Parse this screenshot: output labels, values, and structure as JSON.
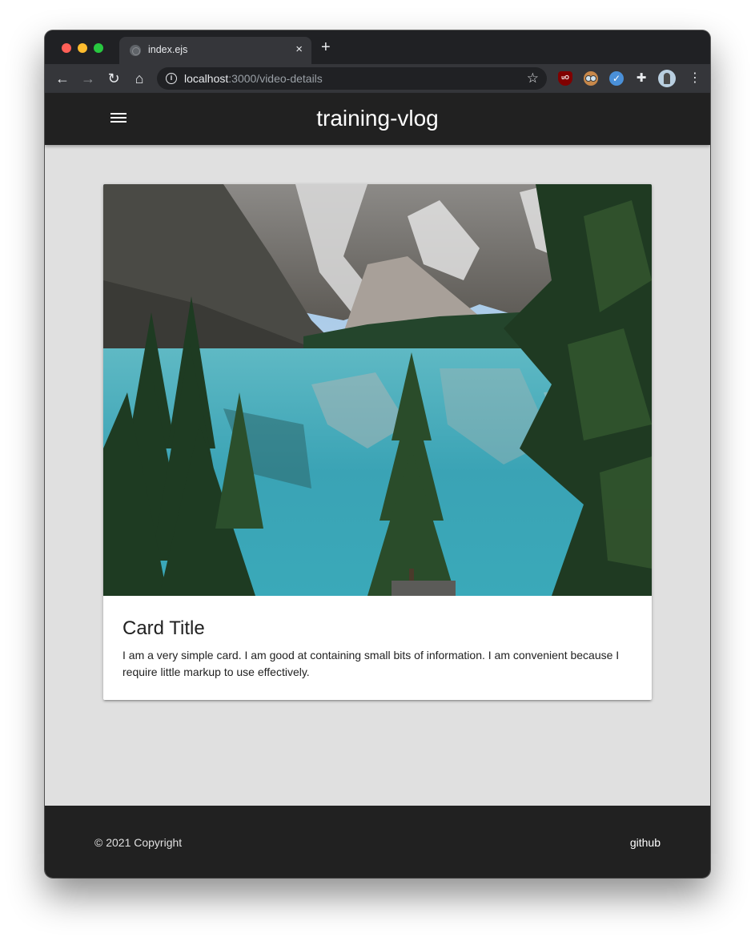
{
  "browser": {
    "tab_title": "index.ejs",
    "tab_close": "×",
    "new_tab": "+",
    "url_host": "localhost",
    "url_rest": ":3000/video-details",
    "nav": {
      "back": "←",
      "forward": "→",
      "reload": "↻",
      "home": "⌂"
    },
    "star": "☆",
    "menu": "⋮",
    "extensions": [
      "ublock-origin-icon",
      "owl-extension-icon",
      "check-extension-icon",
      "puzzle-icon"
    ],
    "ublock_label": "uO"
  },
  "app": {
    "brand": "training-vlog"
  },
  "card": {
    "title": "Card Title",
    "text": "I am a very simple card. I am good at containing small bits of information. I am convenient because I require little markup to use effectively."
  },
  "footer": {
    "copyright": "© 2021 Copyright",
    "link": "github"
  },
  "colors": {
    "header_bg": "#212121",
    "page_bg": "#e0e0e0",
    "card_bg": "#ffffff",
    "lake": "#3fa8b8"
  }
}
